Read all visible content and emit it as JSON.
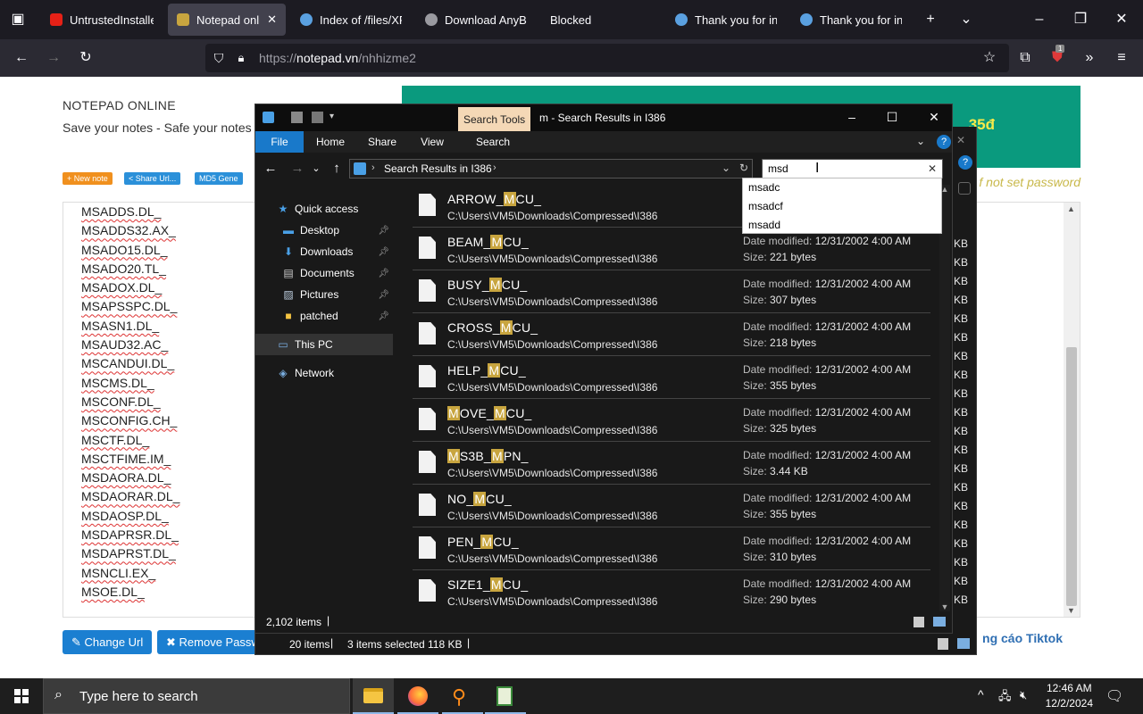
{
  "browser": {
    "tabs": [
      {
        "label": "UntrustedInstaller",
        "icon": "youtube-icon"
      },
      {
        "label": "Notepad online",
        "icon": "notepad-icon",
        "active": true
      },
      {
        "label": "Index of /files/XP",
        "icon": "globe-icon"
      },
      {
        "label": "Download AnyBu",
        "icon": "download-icon"
      },
      {
        "label": "Blocked",
        "icon": ""
      },
      {
        "label": "Thank you for inst",
        "icon": "globe-icon"
      },
      {
        "label": "Thank you for inst",
        "icon": "globe-icon"
      }
    ],
    "url_prefix": "https://",
    "url_host": "notepad.vn",
    "url_path": "/nhhizme2",
    "extension_badge": "1"
  },
  "page": {
    "site_title": "NOTEPAD ONLINE",
    "site_subtitle": "Save your notes - Safe your notes",
    "pills": [
      {
        "label": "+ New note",
        "color": "#f0901e"
      },
      {
        "label": "< Share Url...",
        "color": "#2b90d9"
      },
      {
        "label": "MD5 Gene",
        "color": "#2b90d9"
      }
    ],
    "banner_text": "35đ",
    "password_hint": "f not set password",
    "note_lines": [
      "MSADDS.DL_",
      "MSADDS32.AX_",
      "MSADO15.DL_",
      "MSADO20.TL_",
      "MSADOX.DL_",
      "MSAPSSPC.DL_",
      "MSASN1.DL_",
      "MSAUD32.AC_",
      "MSCANDUI.DL_",
      "MSCMS.DL_",
      "MSCONF.DL_",
      "MSCONFIG.CH_",
      "MSCTF.DL_",
      "MSCTFIME.IM_",
      "MSDAORA.DL_",
      "MSDAORAR.DL_",
      "MSDAOSP.DL_",
      "MSDAPRSR.DL_",
      "MSDAPRST.DL_",
      "MSNCLI.EX_",
      "MSOE.DL_"
    ],
    "change_url_label": "Change Url",
    "remove_password_label": "Remove Password",
    "ad_link": "ng cáo Tiktok"
  },
  "explorer": {
    "search_tools_label": "Search Tools",
    "title": "m - Search Results in I386",
    "ribbon_tabs": [
      "File",
      "Home",
      "Share",
      "View",
      "Search"
    ],
    "address": "Search Results in I386",
    "search_value": "msd",
    "suggestions": [
      "msadc",
      "msadcf",
      "msadd"
    ],
    "nav": [
      {
        "label": "Quick access",
        "icon": "star-icon",
        "pinned": false
      },
      {
        "label": "Desktop",
        "icon": "desktop-icon",
        "pinned": true
      },
      {
        "label": "Downloads",
        "icon": "download-arrow-icon",
        "pinned": true
      },
      {
        "label": "Documents",
        "icon": "documents-icon",
        "pinned": true
      },
      {
        "label": "Pictures",
        "icon": "pictures-icon",
        "pinned": true
      },
      {
        "label": "patched",
        "icon": "folder-icon",
        "pinned": true
      },
      {
        "label": "This PC",
        "icon": "computer-icon",
        "pinned": false
      },
      {
        "label": "Network",
        "icon": "network-icon",
        "pinned": false
      }
    ],
    "files": [
      {
        "pre": "ARROW_",
        "hl": "M",
        "post": "CU_",
        "path": "C:\\Users\\VM5\\Downloads\\Compressed\\I386",
        "date": "",
        "size": ""
      },
      {
        "pre": "BEAM_",
        "hl": "M",
        "post": "CU_",
        "path": "C:\\Users\\VM5\\Downloads\\Compressed\\I386",
        "date": "12/31/2002 4:00 AM",
        "size": "221 bytes"
      },
      {
        "pre": "BUSY_",
        "hl": "M",
        "post": "CU_",
        "path": "C:\\Users\\VM5\\Downloads\\Compressed\\I386",
        "date": "12/31/2002 4:00 AM",
        "size": "307 bytes"
      },
      {
        "pre": "CROSS_",
        "hl": "M",
        "post": "CU_",
        "path": "C:\\Users\\VM5\\Downloads\\Compressed\\I386",
        "date": "12/31/2002 4:00 AM",
        "size": "218 bytes"
      },
      {
        "pre": "HELP_",
        "hl": "M",
        "post": "CU_",
        "path": "C:\\Users\\VM5\\Downloads\\Compressed\\I386",
        "date": "12/31/2002 4:00 AM",
        "size": "355 bytes"
      },
      {
        "pre": "",
        "hl": "M",
        "post": "OVE_",
        "hl2": "M",
        "post2": "CU_",
        "path": "C:\\Users\\VM5\\Downloads\\Compressed\\I386",
        "date": "12/31/2002 4:00 AM",
        "size": "325 bytes"
      },
      {
        "pre": "",
        "hl": "M",
        "post": "S3B_",
        "hl2": "M",
        "post2": "PN_",
        "path": "C:\\Users\\VM5\\Downloads\\Compressed\\I386",
        "date": "12/31/2002 4:00 AM",
        "size": "3.44 KB"
      },
      {
        "pre": "NO_",
        "hl": "M",
        "post": "CU_",
        "path": "C:\\Users\\VM5\\Downloads\\Compressed\\I386",
        "date": "12/31/2002 4:00 AM",
        "size": "355 bytes"
      },
      {
        "pre": "PEN_",
        "hl": "M",
        "post": "CU_",
        "path": "C:\\Users\\VM5\\Downloads\\Compressed\\I386",
        "date": "12/31/2002 4:00 AM",
        "size": "310 bytes"
      },
      {
        "pre": "SIZE1_",
        "hl": "M",
        "post": "CU_",
        "path": "C:\\Users\\VM5\\Downloads\\Compressed\\I386",
        "date": "12/31/2002 4:00 AM",
        "size": "290 bytes"
      }
    ],
    "date_label": "Date modified:",
    "size_label": "Size:",
    "item_count": "2,102 items",
    "back_status": {
      "items": "20 items",
      "selected": "3 items selected",
      "size": "118 KB"
    },
    "back_kb": "KB"
  },
  "taskbar": {
    "search_placeholder": "Type here to search",
    "time": "12:46 AM",
    "date": "12/2/2024"
  }
}
